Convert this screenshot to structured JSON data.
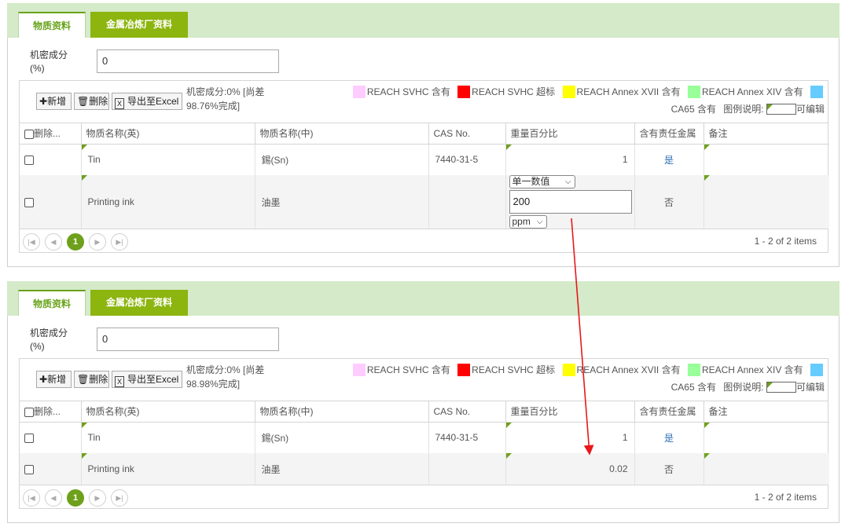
{
  "tabs": {
    "materials": "物质资料",
    "smelter": "金属冶炼厂资料"
  },
  "confidential": {
    "label": "机密成分 (%)",
    "value": "0"
  },
  "toolbar": {
    "add": "新增",
    "delete": "删除",
    "export": "导出至Excel"
  },
  "progress_top": "机密成分:0% [尚差 98.76%完成]",
  "progress_bottom": "机密成分:0% [尚差 98.98%完成]",
  "legend": {
    "items": [
      {
        "label": "REACH SVHC 含有",
        "color": "#ffccff"
      },
      {
        "label": "REACH SVHC 超标",
        "color": "#ff0000"
      },
      {
        "label": "REACH Annex XVII 含有",
        "color": "#ffff00"
      },
      {
        "label": "REACH Annex XIV 含有",
        "color": "#99ff99"
      },
      {
        "label": "CA65 含有",
        "color": "#66ccff"
      }
    ],
    "note_label": "图例说明:",
    "editable_label": "可编辑"
  },
  "columns": [
    "删除...",
    "物质名称(英)",
    "物质名称(中)",
    "CAS No.",
    "重量百分比",
    "含有责任金属",
    "备注"
  ],
  "rows_top": [
    {
      "en": "Tin",
      "cn": "錫(Sn)",
      "cas": "7440-31-5",
      "weight": "1",
      "metal": "是"
    },
    {
      "en": "Printing ink",
      "cn": "油墨",
      "cas": "",
      "weight": "",
      "metal": "否"
    }
  ],
  "edit_cell": {
    "mode": "单一数值",
    "value": "200",
    "unit": "ppm"
  },
  "rows_bottom": [
    {
      "en": "Tin",
      "cn": "錫(Sn)",
      "cas": "7440-31-5",
      "weight": "1",
      "metal": "是"
    },
    {
      "en": "Printing ink",
      "cn": "油墨",
      "cas": "",
      "weight": "0.02",
      "metal": "否"
    }
  ],
  "pager": {
    "current": "1",
    "info": "1 - 2 of 2 items"
  },
  "annotation": {
    "arrow_color": "#e8171b"
  }
}
